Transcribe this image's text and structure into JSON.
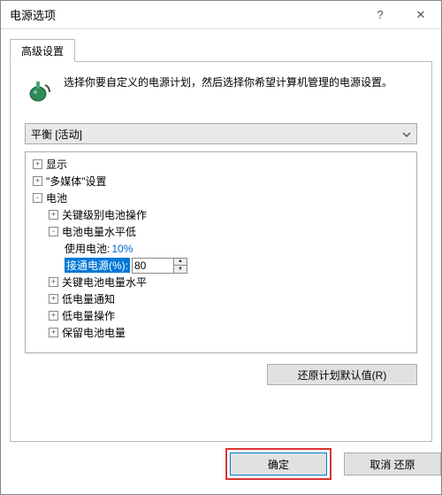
{
  "window": {
    "title": "电源选项"
  },
  "tab": {
    "label": "高级设置"
  },
  "intro": {
    "text": "选择你要自定义的电源计划，然后选择你希望计算机管理的电源设置。"
  },
  "plan_combo": {
    "selected": "平衡 [活动]"
  },
  "tree": {
    "display": {
      "label": "显示",
      "expand": "+"
    },
    "multimedia": {
      "label": "\"多媒体\"设置",
      "expand": "+"
    },
    "battery": {
      "label": "电池",
      "expand": "-"
    },
    "crit_action": {
      "label": "关键级别电池操作",
      "expand": "+"
    },
    "low_level": {
      "label": "电池电量水平低",
      "expand": "-"
    },
    "on_battery": {
      "label": "使用电池:",
      "value": "10%"
    },
    "plugged_in": {
      "label": "接通电源(%):",
      "value": "80"
    },
    "crit_level": {
      "label": "关键电池电量水平",
      "expand": "+"
    },
    "low_notify": {
      "label": "低电量通知",
      "expand": "+"
    },
    "low_action": {
      "label": "低电量操作",
      "expand": "+"
    },
    "reserve": {
      "label": "保留电池电量",
      "expand": "+"
    }
  },
  "buttons": {
    "restore": "还原计划默认值(R)",
    "ok": "确定",
    "cancel": "取消  还原"
  }
}
